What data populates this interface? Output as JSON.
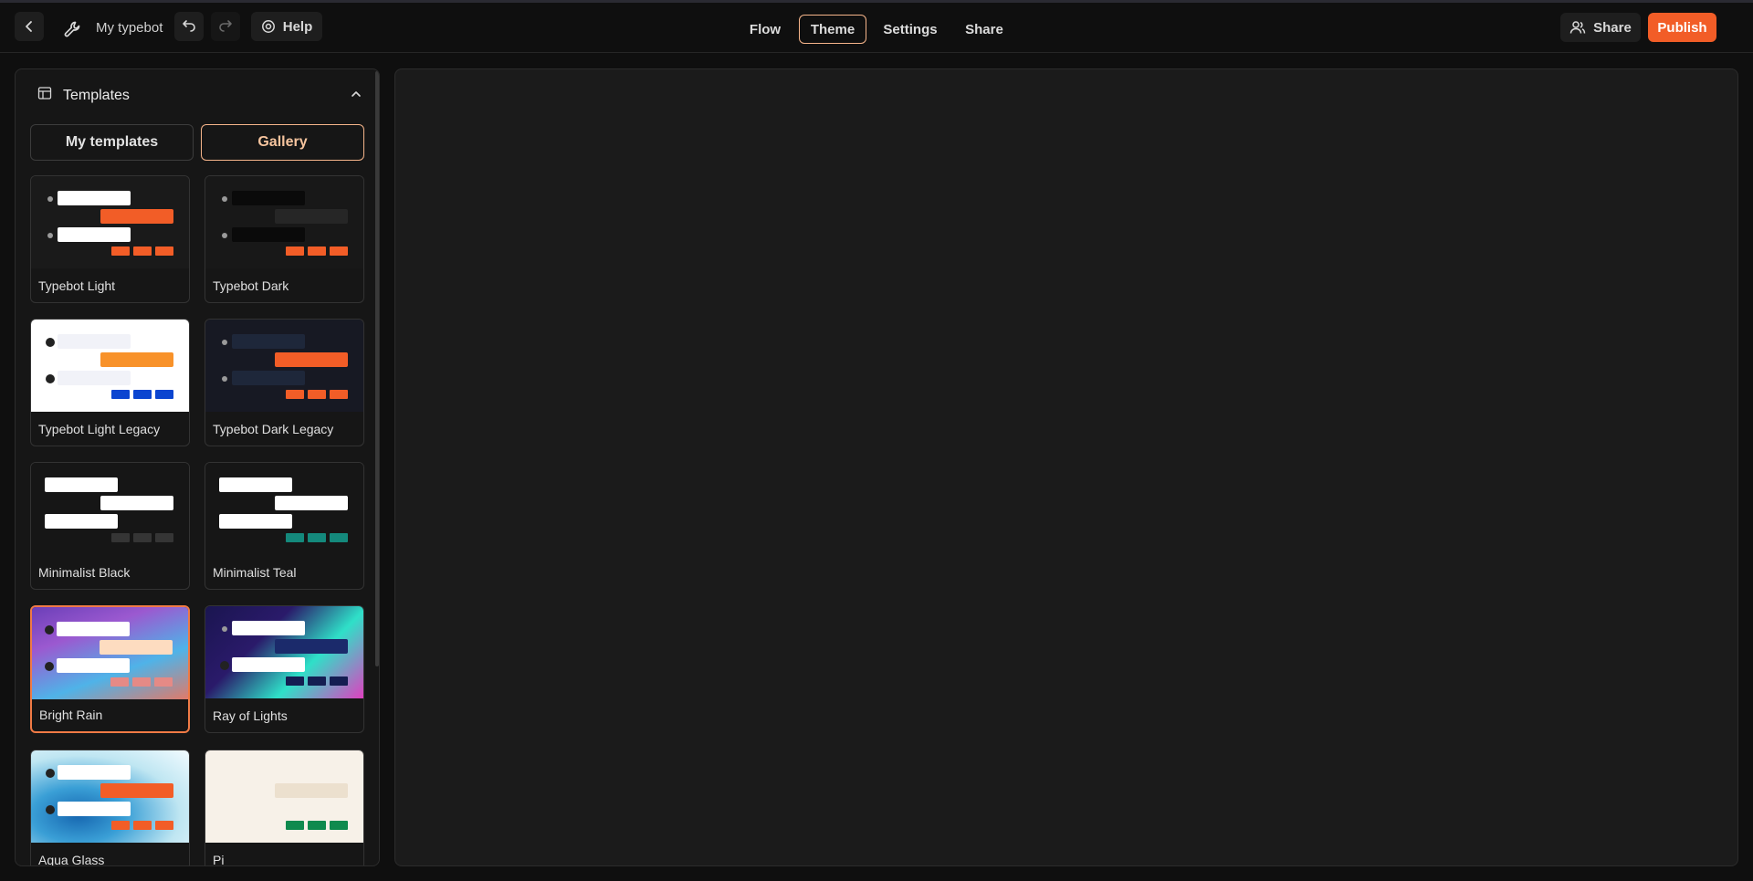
{
  "header": {
    "typebot_name": "My typebot",
    "help_label": "Help",
    "nav": [
      {
        "label": "Flow"
      },
      {
        "label": "Theme",
        "active": true
      },
      {
        "label": "Settings"
      },
      {
        "label": "Share"
      }
    ],
    "share_label": "Share",
    "publish_label": "Publish",
    "icons": [
      "back-icon",
      "wrench-icon",
      "undo-icon",
      "redo-icon",
      "help-icon",
      "users-icon"
    ]
  },
  "sidebar": {
    "title": "Templates",
    "tabs": [
      "My templates",
      "Gallery"
    ],
    "active_tab": "Gallery",
    "templates": [
      {
        "name": "Typebot Light",
        "selected": false
      },
      {
        "name": "Typebot Dark",
        "selected": false
      },
      {
        "name": "Typebot Light Legacy",
        "selected": false
      },
      {
        "name": "Typebot Dark Legacy",
        "selected": false
      },
      {
        "name": "Minimalist Black",
        "selected": false
      },
      {
        "name": "Minimalist Teal",
        "selected": false
      },
      {
        "name": "Bright Rain",
        "selected": true
      },
      {
        "name": "Ray of Lights",
        "selected": false
      },
      {
        "name": "Aqua Glass",
        "selected": false
      },
      {
        "name": "Pi",
        "selected": false
      }
    ]
  },
  "colors": {
    "accent": "#f25d27",
    "active_border": "#f5b48a"
  }
}
